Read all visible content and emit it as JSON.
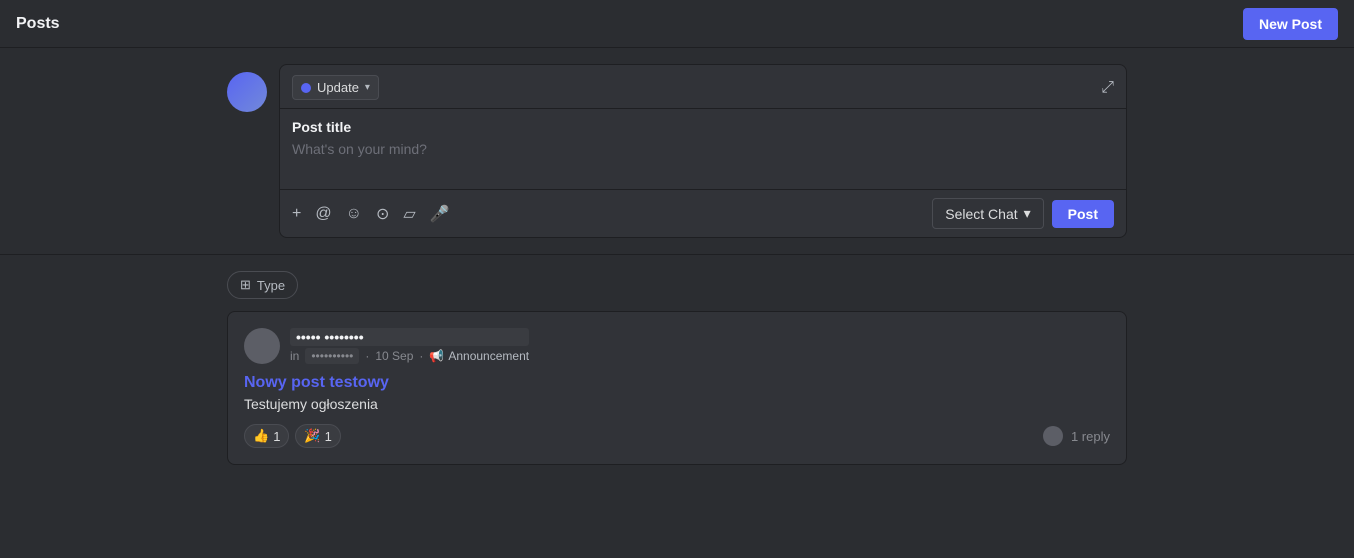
{
  "header": {
    "title": "Posts",
    "new_post_label": "New Post"
  },
  "composer": {
    "update_badge_label": "Update",
    "post_title_label": "Post title",
    "placeholder": "What's on your mind?",
    "select_chat_label": "Select Chat",
    "post_button_label": "Post",
    "toolbar_icons": [
      {
        "name": "plus-icon",
        "symbol": "+"
      },
      {
        "name": "mention-icon",
        "symbol": "@"
      },
      {
        "name": "emoji-icon",
        "symbol": "☺"
      },
      {
        "name": "gif-icon",
        "symbol": "⊙"
      },
      {
        "name": "image-icon",
        "symbol": "▱"
      },
      {
        "name": "mic-icon",
        "symbol": "🎤"
      }
    ]
  },
  "filter": {
    "type_label": "Type"
  },
  "post": {
    "author_name": "••••• ••••••••",
    "in_label": "in",
    "channel": "••••••••••",
    "date": "10 Sep",
    "announcement_label": "Announcement",
    "title": "Nowy post testowy",
    "content": "Testujemy ogłoszenia",
    "reactions": [
      {
        "emoji": "👍",
        "count": "1"
      },
      {
        "emoji": "🎉",
        "count": "1"
      }
    ],
    "reply_count": "1 reply"
  }
}
